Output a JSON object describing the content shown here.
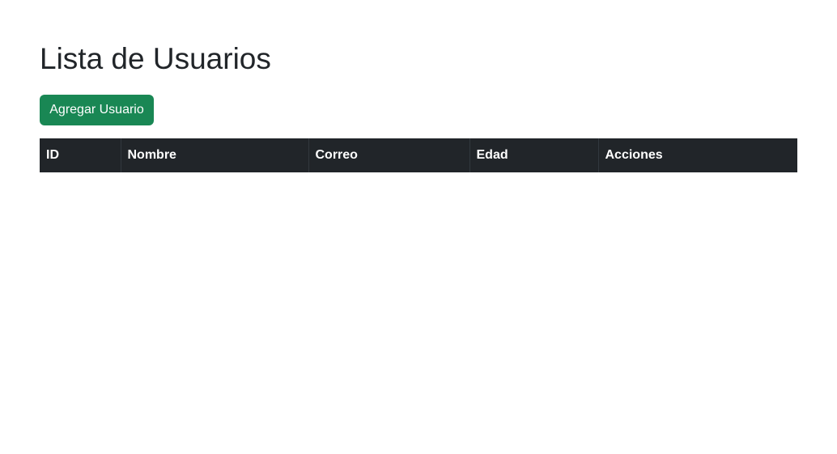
{
  "page": {
    "title": "Lista de Usuarios"
  },
  "toolbar": {
    "add_user_label": "Agregar Usuario"
  },
  "table": {
    "columns": [
      "ID",
      "Nombre",
      "Correo",
      "Edad",
      "Acciones"
    ],
    "rows": []
  },
  "colors": {
    "primary_text": "#212529",
    "success_button": "#198754",
    "table_header_bg": "#212529",
    "table_header_text": "#ffffff"
  }
}
